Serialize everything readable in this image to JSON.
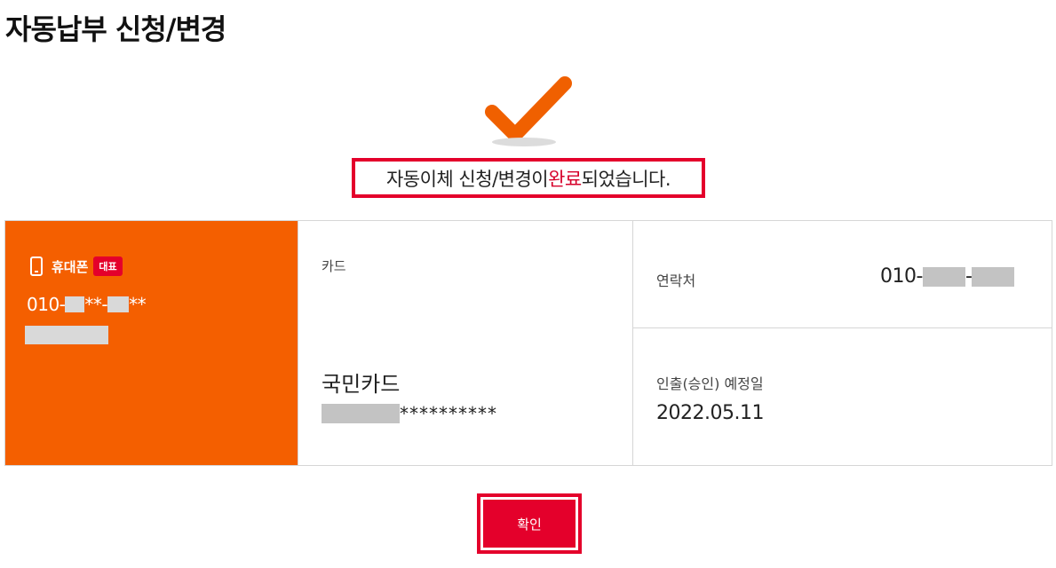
{
  "page": {
    "title": "자동납부 신청/변경"
  },
  "result": {
    "message_prefix": "자동이체 신청/변경이 ",
    "message_accent": "완료",
    "message_suffix": "되었습니다.",
    "icon": "check-icon"
  },
  "phone": {
    "icon": "mobile-phone-icon",
    "label": "휴대폰",
    "badge": "대표",
    "number_prefix": "010-",
    "number_mid": "**-",
    "number_suffix": "**"
  },
  "card": {
    "type_label": "카드",
    "name": "국민카드",
    "number_masked": "**********"
  },
  "contact": {
    "label": "연락처",
    "value_prefix": "010-",
    "value_sep": "-"
  },
  "withdrawal": {
    "label": "인출(승인) 예정일",
    "date": "2022.05.11"
  },
  "actions": {
    "confirm_label": "확인"
  },
  "colors": {
    "accent_red": "#e4002b",
    "phone_panel_orange": "#f45f00",
    "check_orange": "#f06000"
  }
}
